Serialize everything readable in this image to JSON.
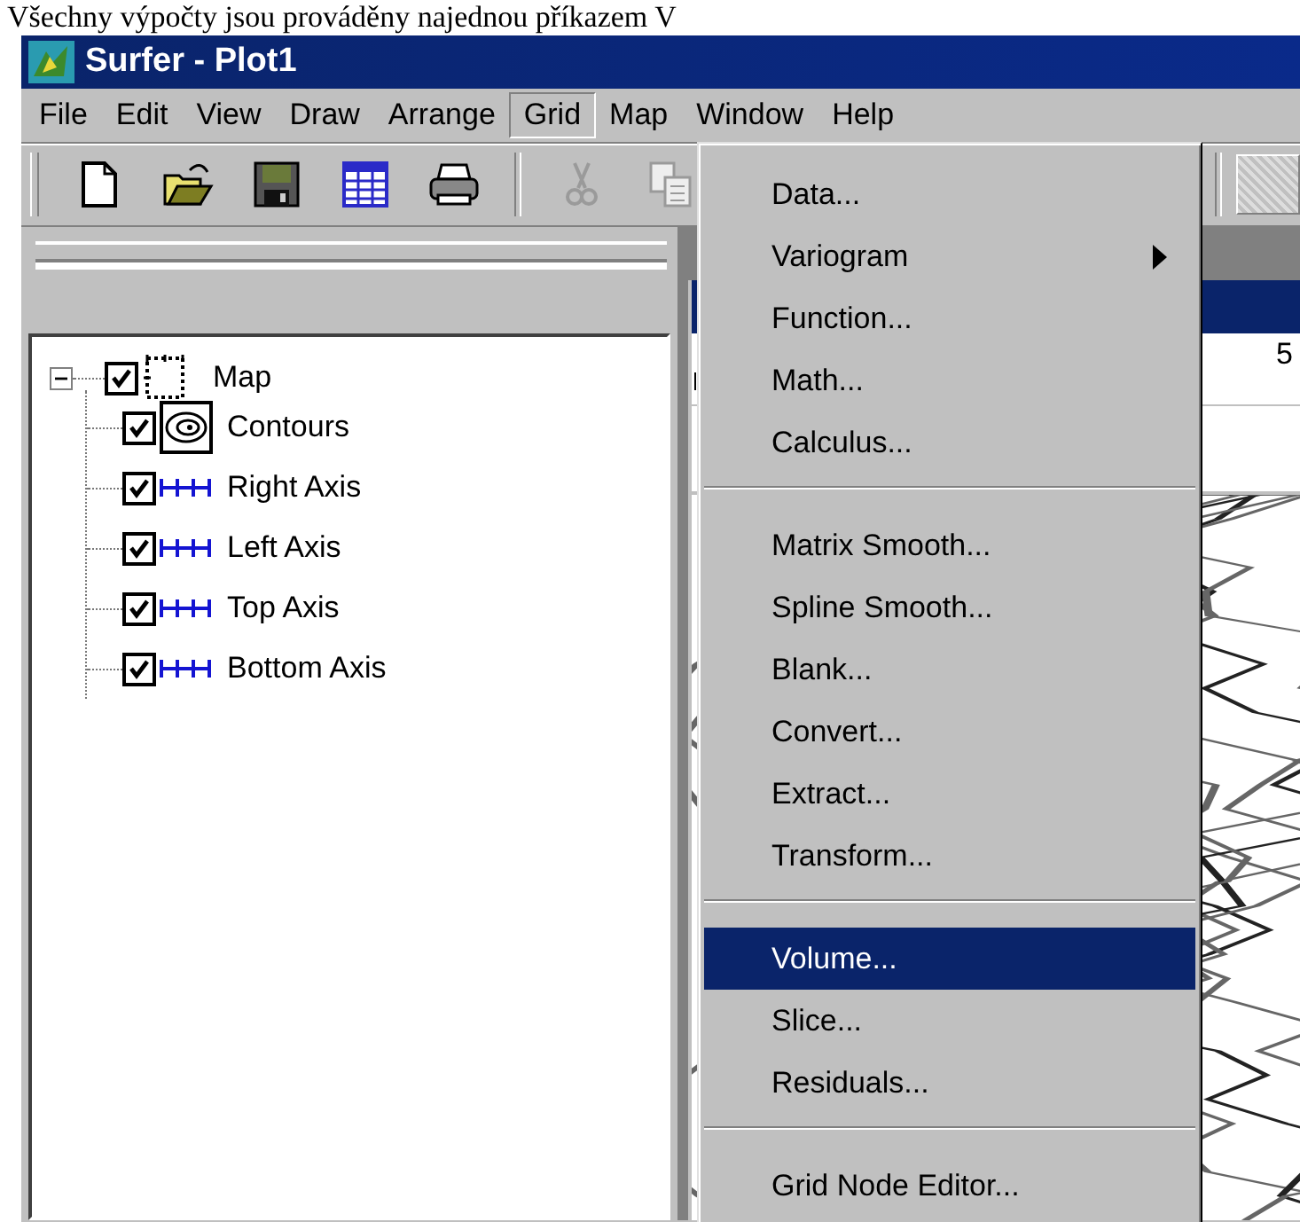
{
  "caption": "Všechny výpočty jsou prováděny najednou příkazem V",
  "window": {
    "title": "Surfer - Plot1"
  },
  "menubar": [
    {
      "label": "File",
      "selected": false
    },
    {
      "label": "Edit",
      "selected": false
    },
    {
      "label": "View",
      "selected": false
    },
    {
      "label": "Draw",
      "selected": false
    },
    {
      "label": "Arrange",
      "selected": false
    },
    {
      "label": "Grid",
      "selected": true
    },
    {
      "label": "Map",
      "selected": false
    },
    {
      "label": "Window",
      "selected": false
    },
    {
      "label": "Help",
      "selected": false
    }
  ],
  "toolbar": [
    {
      "kind": "new",
      "disabled": false
    },
    {
      "kind": "open",
      "disabled": false
    },
    {
      "kind": "save",
      "disabled": false
    },
    {
      "kind": "worksheet",
      "disabled": false
    },
    {
      "kind": "print",
      "disabled": false
    },
    {
      "kind": "separator"
    },
    {
      "kind": "cut",
      "disabled": true
    },
    {
      "kind": "copy",
      "disabled": true
    }
  ],
  "tree": [
    {
      "label": "Map",
      "kind": "map",
      "checked": true,
      "expanded": true,
      "children": [
        {
          "label": "Contours",
          "kind": "contours",
          "checked": true
        },
        {
          "label": "Right Axis",
          "kind": "axis",
          "checked": true
        },
        {
          "label": "Left Axis",
          "kind": "axis",
          "checked": true
        },
        {
          "label": "Top Axis",
          "kind": "axis",
          "checked": true
        },
        {
          "label": "Bottom Axis",
          "kind": "axis",
          "checked": true
        }
      ]
    }
  ],
  "plot_window": {
    "ruler_label": "5"
  },
  "grid_menu": {
    "items": [
      {
        "kind": "item",
        "label": "Data...",
        "submenu": false,
        "selected": false
      },
      {
        "kind": "item",
        "label": "Variogram",
        "submenu": true,
        "selected": false
      },
      {
        "kind": "item",
        "label": "Function...",
        "submenu": false,
        "selected": false
      },
      {
        "kind": "item",
        "label": "Math...",
        "submenu": false,
        "selected": false
      },
      {
        "kind": "item",
        "label": "Calculus...",
        "submenu": false,
        "selected": false
      },
      {
        "kind": "separator"
      },
      {
        "kind": "item",
        "label": "Matrix Smooth...",
        "submenu": false,
        "selected": false
      },
      {
        "kind": "item",
        "label": "Spline Smooth...",
        "submenu": false,
        "selected": false
      },
      {
        "kind": "item",
        "label": "Blank...",
        "submenu": false,
        "selected": false
      },
      {
        "kind": "item",
        "label": "Convert...",
        "submenu": false,
        "selected": false
      },
      {
        "kind": "item",
        "label": "Extract...",
        "submenu": false,
        "selected": false
      },
      {
        "kind": "item",
        "label": "Transform...",
        "submenu": false,
        "selected": false
      },
      {
        "kind": "separator"
      },
      {
        "kind": "item",
        "label": "Volume...",
        "submenu": false,
        "selected": true
      },
      {
        "kind": "item",
        "label": "Slice...",
        "submenu": false,
        "selected": false
      },
      {
        "kind": "item",
        "label": "Residuals...",
        "submenu": false,
        "selected": false
      },
      {
        "kind": "separator"
      },
      {
        "kind": "item",
        "label": "Grid Node Editor...",
        "submenu": false,
        "selected": false
      }
    ]
  }
}
